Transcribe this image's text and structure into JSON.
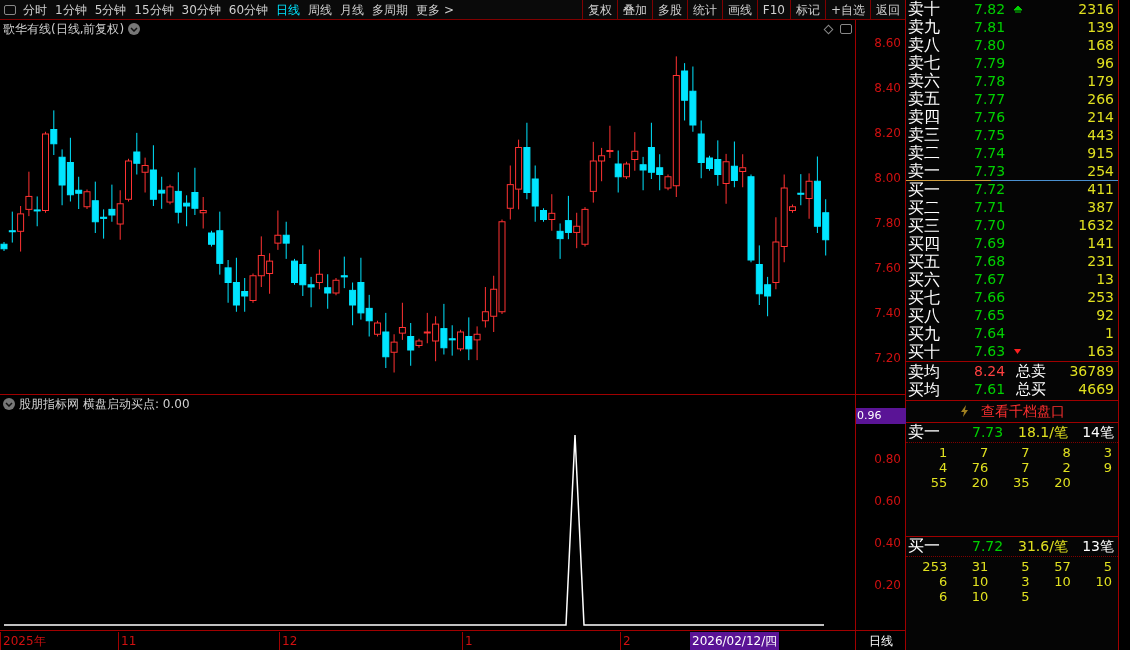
{
  "toolbar": {
    "periods": [
      {
        "label": "分时",
        "selected": false
      },
      {
        "label": "1分钟",
        "selected": false
      },
      {
        "label": "5分钟",
        "selected": false
      },
      {
        "label": "15分钟",
        "selected": false
      },
      {
        "label": "30分钟",
        "selected": false
      },
      {
        "label": "60分钟",
        "selected": false
      },
      {
        "label": "日线",
        "selected": true
      },
      {
        "label": "周线",
        "selected": false
      },
      {
        "label": "月线",
        "selected": false
      },
      {
        "label": "多周期",
        "selected": false
      }
    ],
    "more": "更多 >",
    "actions": [
      "复权",
      "叠加",
      "多股",
      "统计",
      "画线",
      "F10",
      "标记",
      "+自选",
      "返回"
    ]
  },
  "chart": {
    "title": "歌华有线(日线,前复权)",
    "yticks": [
      "8.60",
      "8.40",
      "8.20",
      "8.00",
      "7.80",
      "7.60",
      "7.40",
      "7.20"
    ]
  },
  "indicator": {
    "title": "股朋指标网",
    "formula": "横盘启动买点: 0.00",
    "current": "0.96",
    "yticks": [
      "0.80",
      "0.60",
      "0.40",
      "0.20"
    ]
  },
  "date_axis": {
    "labels": [
      "2025年",
      "11",
      "12",
      "1",
      "2"
    ],
    "cursor_date": "2026/02/12/四",
    "period": "日线"
  },
  "order_book": {
    "asks": [
      {
        "label": "卖十",
        "price": "7.82",
        "volume": "2316",
        "up_arrow": true,
        "down_arrow": false
      },
      {
        "label": "卖九",
        "price": "7.81",
        "volume": "139",
        "up_arrow": false,
        "down_arrow": false
      },
      {
        "label": "卖八",
        "price": "7.80",
        "volume": "168",
        "up_arrow": false,
        "down_arrow": false
      },
      {
        "label": "卖七",
        "price": "7.79",
        "volume": "96",
        "up_arrow": false,
        "down_arrow": false
      },
      {
        "label": "卖六",
        "price": "7.78",
        "volume": "179",
        "up_arrow": false,
        "down_arrow": false
      },
      {
        "label": "卖五",
        "price": "7.77",
        "volume": "266",
        "up_arrow": false,
        "down_arrow": false
      },
      {
        "label": "卖四",
        "price": "7.76",
        "volume": "214",
        "up_arrow": false,
        "down_arrow": false
      },
      {
        "label": "卖三",
        "price": "7.75",
        "volume": "443",
        "up_arrow": false,
        "down_arrow": false
      },
      {
        "label": "卖二",
        "price": "7.74",
        "volume": "915",
        "up_arrow": false,
        "down_arrow": false
      },
      {
        "label": "卖一",
        "price": "7.73",
        "volume": "254",
        "up_arrow": false,
        "down_arrow": false
      }
    ],
    "bids": [
      {
        "label": "买一",
        "price": "7.72",
        "volume": "411",
        "up_arrow": false,
        "down_arrow": false
      },
      {
        "label": "买二",
        "price": "7.71",
        "volume": "387",
        "up_arrow": false,
        "down_arrow": false
      },
      {
        "label": "买三",
        "price": "7.70",
        "volume": "1632",
        "up_arrow": false,
        "down_arrow": false
      },
      {
        "label": "买四",
        "price": "7.69",
        "volume": "141",
        "up_arrow": false,
        "down_arrow": false
      },
      {
        "label": "买五",
        "price": "7.68",
        "volume": "231",
        "up_arrow": false,
        "down_arrow": false
      },
      {
        "label": "买六",
        "price": "7.67",
        "volume": "13",
        "up_arrow": false,
        "down_arrow": false
      },
      {
        "label": "买七",
        "price": "7.66",
        "volume": "253",
        "up_arrow": false,
        "down_arrow": false
      },
      {
        "label": "买八",
        "price": "7.65",
        "volume": "92",
        "up_arrow": false,
        "down_arrow": false
      },
      {
        "label": "买九",
        "price": "7.64",
        "volume": "1",
        "up_arrow": false,
        "down_arrow": false
      },
      {
        "label": "买十",
        "price": "7.63",
        "volume": "163",
        "up_arrow": false,
        "down_arrow": true
      }
    ],
    "averages": [
      {
        "label": "卖均",
        "price": "8.24",
        "color": "#ff4040",
        "total_label": "总卖",
        "total": "36789"
      },
      {
        "label": "买均",
        "price": "7.61",
        "color": "#00d000",
        "total_label": "总买",
        "total": "4669"
      }
    ],
    "depth_link": "查看千档盘口",
    "queues": [
      {
        "label": "卖一",
        "price": "7.73",
        "avg": "18.1/笔",
        "count": "14笔",
        "orders": [
          [
            "1",
            "7",
            "7",
            "8",
            "3"
          ],
          [
            "4",
            "76",
            "7",
            "2",
            "9"
          ],
          [
            "55",
            "20",
            "35",
            "20"
          ]
        ]
      },
      {
        "label": "买一",
        "price": "7.72",
        "avg": "31.6/笔",
        "count": "13笔",
        "orders": [
          [
            "253",
            "31",
            "5",
            "57",
            "5"
          ],
          [
            "6",
            "10",
            "3",
            "10",
            "10"
          ],
          [
            "6",
            "10",
            "5"
          ]
        ]
      }
    ]
  }
}
